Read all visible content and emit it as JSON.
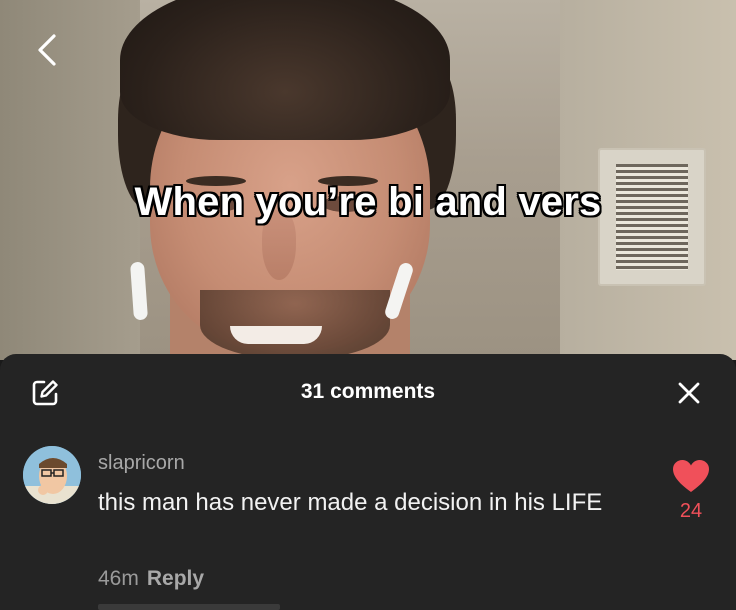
{
  "video": {
    "caption": "When you’re bi and vers"
  },
  "sheet": {
    "comment_count_label": "31 comments"
  },
  "comments": [
    {
      "username": "slapricorn",
      "text": "this man has never made a decision in his LIFE",
      "time": "46m",
      "reply_label": "Reply",
      "likes": "24"
    }
  ],
  "icons": {
    "back": "chevron-left-icon",
    "edit": "edit-icon",
    "close": "close-icon",
    "like": "heart-icon"
  },
  "colors": {
    "sheet_bg": "#242424",
    "like": "#f0505a",
    "text_primary": "#f2f2f2",
    "text_secondary": "#a8a8a8"
  }
}
